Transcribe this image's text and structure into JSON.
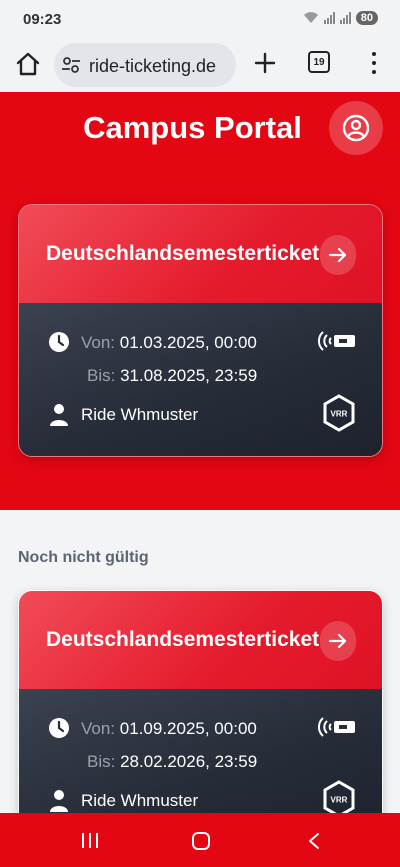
{
  "status_bar": {
    "time": "09:23",
    "battery": "80"
  },
  "browser": {
    "url": "ride-ticketing.de",
    "tab_count": "19"
  },
  "header": {
    "title": "Campus Portal"
  },
  "section": {
    "not_yet_valid": "Noch nicht gültig"
  },
  "tickets": [
    {
      "name": "Deutschlandsemesterticket",
      "from_label": "Von:",
      "from_value": "01.03.2025, 00:00",
      "to_label": "Bis:",
      "to_value": "31.08.2025, 23:59",
      "holder": "Ride Whmuster",
      "operator_logo": "VRR"
    },
    {
      "name": "Deutschlandsemesterticket",
      "from_label": "Von:",
      "from_value": "01.09.2025, 00:00",
      "to_label": "Bis:",
      "to_value": "28.02.2026, 23:59",
      "holder": "Ride Whmuster",
      "operator_logo": "VRR"
    }
  ],
  "colors": {
    "brand_red": "#e30613",
    "card_dark": "#262c38",
    "label_grey": "#9aa0ab"
  },
  "icons": [
    "home-icon",
    "site-settings-icon",
    "plus-icon",
    "tab-switcher-icon",
    "more-icon",
    "profile-icon",
    "arrow-right-icon",
    "clock-icon",
    "person-icon",
    "nfc-card-icon",
    "vrr-logo-icon",
    "recents-icon",
    "nav-home-icon",
    "back-icon"
  ]
}
